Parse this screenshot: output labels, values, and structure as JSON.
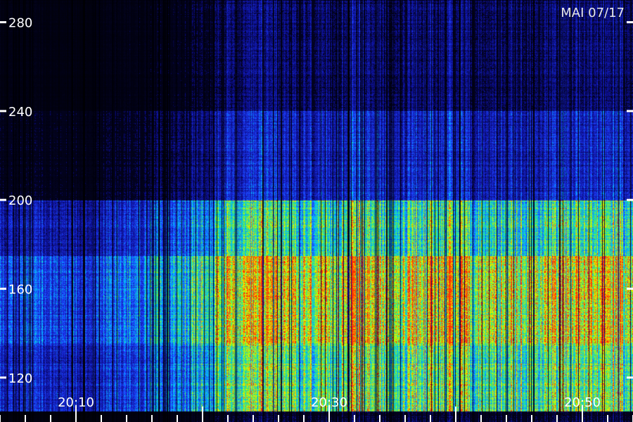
{
  "chart_data": {
    "type": "heatmap",
    "title": "",
    "corner_label": "MAI 07/17",
    "xlabel": "",
    "ylabel": "",
    "x_range": [
      "20:04",
      "20:54"
    ],
    "x_tick_labels": [
      "20:10",
      "20:30",
      "20:50"
    ],
    "x_minor_tick_minutes": 2,
    "y_range": [
      100,
      290
    ],
    "y_tick_values": [
      120,
      160,
      200,
      240,
      280
    ],
    "y_tick_labels": [
      "120",
      "160",
      "200",
      "240",
      "280"
    ],
    "colormap": [
      "#000000",
      "#0a0a80",
      "#1e3cff",
      "#00c8ff",
      "#30e080",
      "#b8ff00",
      "#ffe000",
      "#ff3000"
    ],
    "intensity_bands": [
      {
        "y_from": 105,
        "y_to": 135,
        "level": 0.62
      },
      {
        "y_from": 135,
        "y_to": 175,
        "level": 0.8
      },
      {
        "y_from": 175,
        "y_to": 200,
        "level": 0.55
      },
      {
        "y_from": 200,
        "y_to": 240,
        "level": 0.22
      },
      {
        "y_from": 240,
        "y_to": 290,
        "level": 0.14
      }
    ],
    "activity_onset_time": "20:11",
    "activity_rise_time": "20:21",
    "peak_bursts_times": [
      "20:25",
      "20:32",
      "20:39",
      "20:50",
      "20:52"
    ],
    "grid": false,
    "legend": "none"
  }
}
